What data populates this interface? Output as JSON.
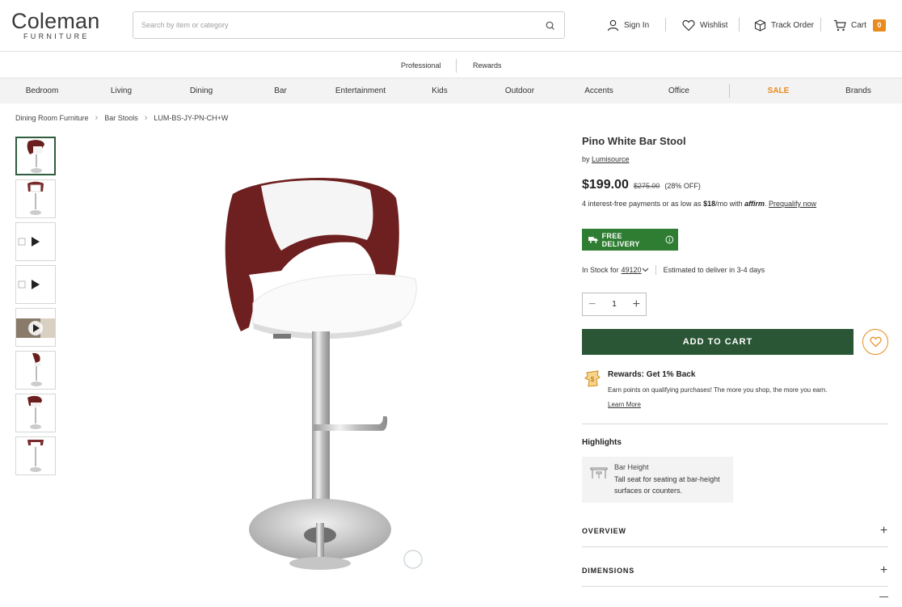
{
  "header": {
    "logo_main": "Coleman",
    "logo_sub": "FURNITURE",
    "search_placeholder": "Search by item or category",
    "sign_in": "Sign In",
    "wishlist": "Wishlist",
    "track_order": "Track Order",
    "cart": "Cart",
    "cart_count": "0"
  },
  "subbar": {
    "professional": "Professional",
    "rewards": "Rewards"
  },
  "categories": [
    "Bedroom",
    "Living",
    "Dining",
    "Bar",
    "Entertainment",
    "Kids",
    "Outdoor",
    "Accents",
    "Office",
    "SALE",
    "Brands"
  ],
  "breadcrumb": [
    "Dining Room Furniture",
    "Bar Stools",
    "LUM-BS-JY-PN-CH+W"
  ],
  "product": {
    "title": "Pino White Bar Stool",
    "by": "by",
    "brand": "Lumisource",
    "price": "$199.00",
    "old_price": "$275.00",
    "discount": "(28% OFF)",
    "affirm_text": "4 interest-free payments or as low as",
    "affirm_amount": "$18",
    "affirm_per": "/mo with",
    "affirm_logo": "affirm",
    "affirm_link": "Prequalify now",
    "delivery_badge": "FREE DELIVERY",
    "stock_text": "In Stock for",
    "zip": "49120",
    "estimate": "Estimated to deliver in 3-4 days",
    "quantity": "1",
    "add_to_cart": "ADD TO CART"
  },
  "rewards": {
    "title": "Rewards: Get 1% Back",
    "desc": "Earn points on qualifying purchases! The more you shop, the more you earn.",
    "link": "Learn More"
  },
  "highlights": {
    "title": "Highlights",
    "item_name": "Bar Height",
    "item_desc": "Tall seat for seating at bar-height surfaces or counters."
  },
  "accordions": {
    "overview": "OVERVIEW",
    "dimensions": "DIMENSIONS"
  },
  "colors": {
    "green": "#2b5636",
    "delivery_green": "#2e7d32",
    "orange": "#e98b1e"
  }
}
